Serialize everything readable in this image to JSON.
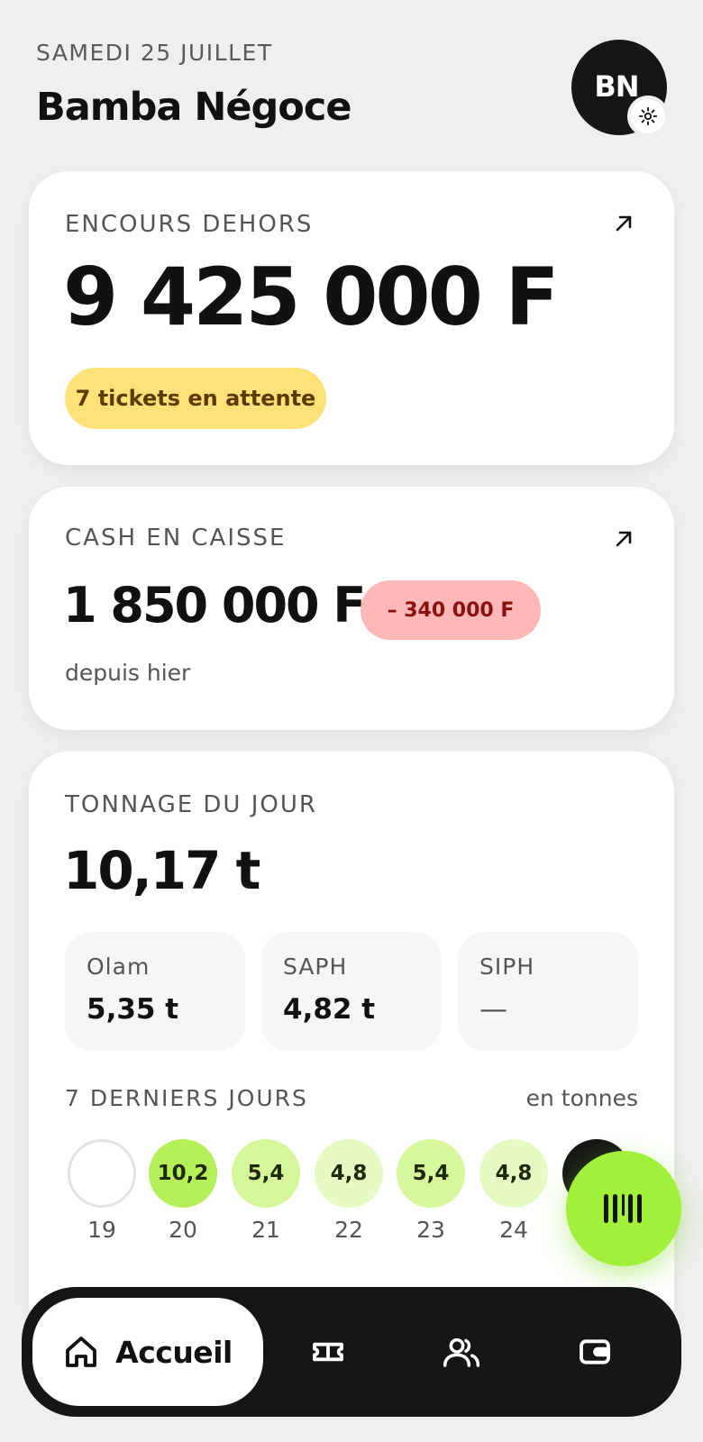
{
  "header": {
    "date": "SAMEDI 25 JUILLET",
    "title": "Bamba Négoce",
    "avatar_initials": "BN",
    "avatar_badge_icon": "sun-icon"
  },
  "encours": {
    "label": "ENCOURS DEHORS",
    "amount": "9 425 000 F",
    "tickets_pill": "7 tickets en attente",
    "pill_color": "#fde27a",
    "pill_text_color": "#5b3b00",
    "icon": "arrow-up-right-icon"
  },
  "cash": {
    "label": "CASH EN CAISSE",
    "amount": "1 850 000 F",
    "delta": "– 340 000 F",
    "delta_color": "#ffb7b7",
    "delta_text_color": "#8a1010",
    "delta_note": "depuis hier",
    "icon": "arrow-up-right-icon"
  },
  "tonnage": {
    "label": "TONNAGE DU JOUR",
    "total": "10,17 t",
    "splits": [
      {
        "name": "Olam",
        "value": "5,35 t"
      },
      {
        "name": "SAPH",
        "value": "4,82 t"
      },
      {
        "name": "SIPH",
        "value": "—"
      }
    ],
    "days_label": "7 DERNIERS JOURS",
    "days_unit": "en tonnes",
    "days": [
      {
        "day": "19",
        "value": "",
        "color": "#ffffff"
      },
      {
        "day": "20",
        "value": "10,2",
        "color": "#b5f05a"
      },
      {
        "day": "21",
        "value": "5,4",
        "color": "#d6f79b"
      },
      {
        "day": "22",
        "value": "4,8",
        "color": "#e6fbc3"
      },
      {
        "day": "23",
        "value": "5,4",
        "color": "#d6f79b"
      },
      {
        "day": "24",
        "value": "4,8",
        "color": "#e6fbc3"
      },
      {
        "day": "",
        "value": "",
        "color": "#161616"
      }
    ]
  },
  "fab": {
    "icon": "barcode-scan-icon",
    "color": "#a3f03b"
  },
  "nav": {
    "home_label": "Accueil",
    "home_icon": "home-icon",
    "items": [
      "ticket-icon",
      "users-icon",
      "wallet-icon"
    ]
  }
}
